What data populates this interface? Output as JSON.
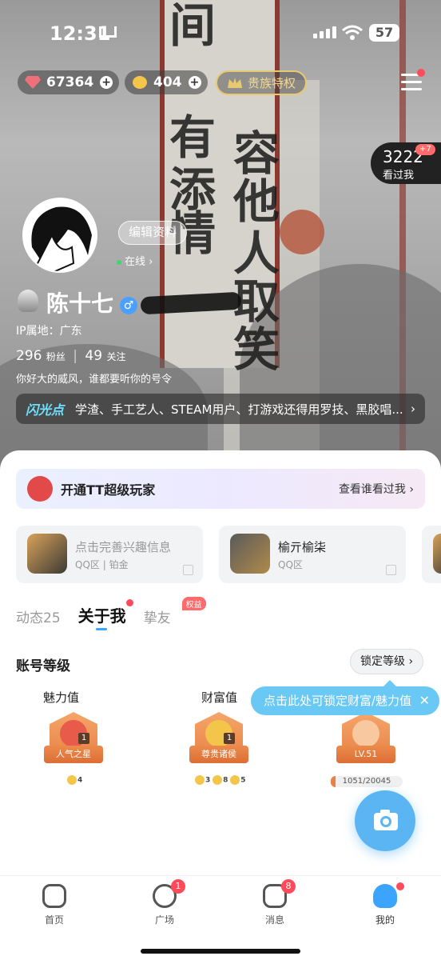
{
  "status_bar": {
    "time": "12:31",
    "battery": "57"
  },
  "top": {
    "diamonds": "67364",
    "beans": "404",
    "vip_label": "贵族特权"
  },
  "visitors": {
    "count": "3222",
    "label": "看过我",
    "badge": "+7"
  },
  "hero_calligraphy": [
    "间",
    "有",
    "添",
    "情",
    "容",
    "他",
    "人",
    "取",
    "笑"
  ],
  "profile": {
    "edit_label": "编辑资料",
    "online_label": "在线",
    "nickname": "陈十七",
    "gender_symbol": "♂",
    "ip_location": "IP属地：广东",
    "fans_count": "296",
    "fans_label": "粉丝",
    "follow_count": "49",
    "follow_label": "关注",
    "bio": "你好大的威风，谁都要听你的号令"
  },
  "flash": {
    "title": "闪光点",
    "text": "学渣、手工艺人、STEAM用户、打游戏还得用罗技、黑胶唱..."
  },
  "banner": {
    "title": "开通TT超级玩家",
    "right_label": "查看谁看过我"
  },
  "games": [
    {
      "title": "点击完善兴趣信息",
      "subtitle": "QQ区 | 铂金"
    },
    {
      "title": "榆亓榆柒",
      "subtitle": "QQ区"
    }
  ],
  "tabs": [
    {
      "label": "动态25"
    },
    {
      "label": "关于我"
    },
    {
      "label": "挚友",
      "badge": "权益"
    }
  ],
  "level_section": {
    "title": "账号等级",
    "lock_button": "锁定等级",
    "tip": "点击此处可锁定财富/魅力值",
    "charm": {
      "label": "魅力值",
      "ribbon": "人气之星",
      "level": "1",
      "mini": "4"
    },
    "wealth": {
      "label": "财富值",
      "ribbon": "尊贵诸侯",
      "level": "1",
      "mini": [
        "3",
        "8",
        "5"
      ]
    },
    "account": {
      "ribbon": "LV.51",
      "progress_text": "1051/20045",
      "progress": 0.0525
    }
  },
  "bottom_nav": [
    {
      "label": "首页",
      "icon": "home-icon"
    },
    {
      "label": "广场",
      "icon": "compass-icon",
      "badge": "1"
    },
    {
      "label": "消息",
      "icon": "message-icon",
      "badge": "8"
    },
    {
      "label": "我的",
      "icon": "profile-icon"
    }
  ],
  "colors": {
    "accent": "#3aa4ff",
    "badge": "#ff4a5a",
    "tip": "#6ac8f5",
    "flash_title": "#6fe0ff"
  }
}
